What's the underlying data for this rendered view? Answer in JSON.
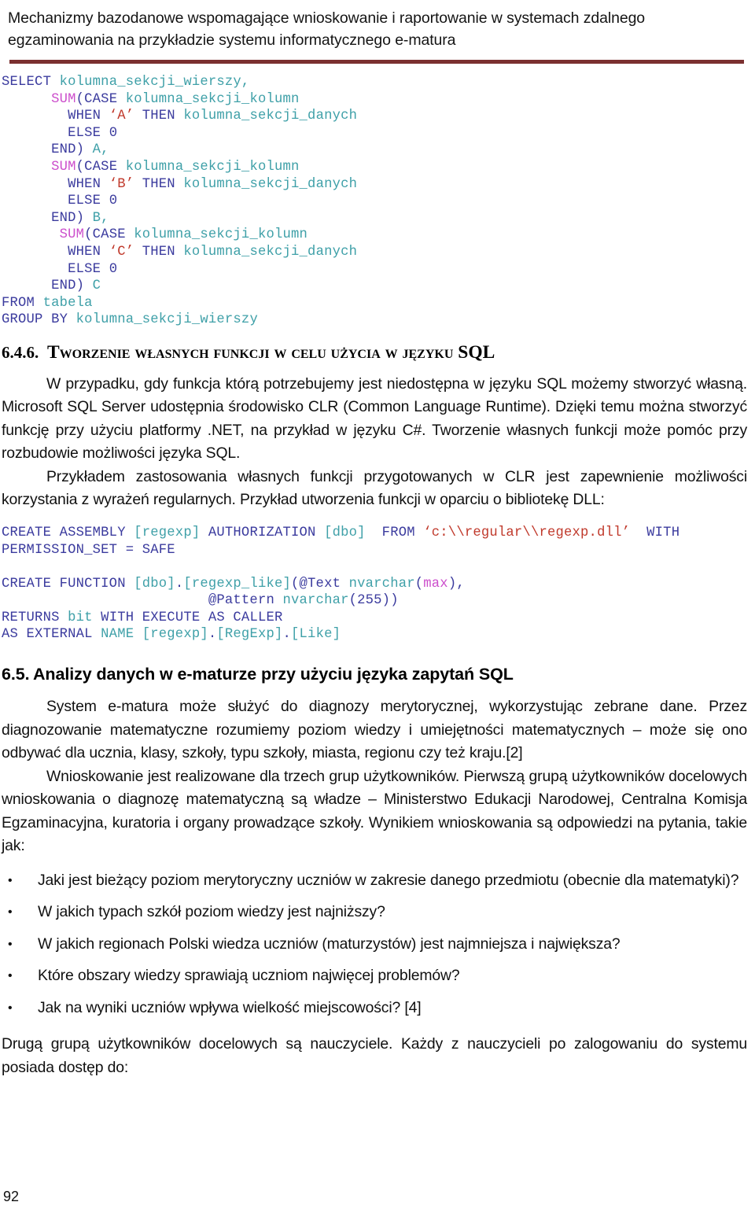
{
  "header": {
    "line1": "Mechanizmy bazodanowe wspomagające wnioskowanie i raportowanie w systemach zdalnego",
    "line2": "egzaminowania na przykładzie systemu informatycznego e-matura",
    "rule_color": "#7B3030"
  },
  "code_block_1": {
    "language": "SQL",
    "tokens": [
      [
        {
          "t": "SELECT ",
          "c": "k"
        },
        {
          "t": "kolumna_sekcji_wierszy,",
          "c": "id"
        }
      ],
      [
        {
          "t": "      ",
          "c": "pl"
        },
        {
          "t": "SUM",
          "c": "fn"
        },
        {
          "t": "(",
          "c": "pl"
        },
        {
          "t": "CASE ",
          "c": "k"
        },
        {
          "t": "kolumna_sekcji_kolumn",
          "c": "id"
        }
      ],
      [
        {
          "t": "        ",
          "c": "pl"
        },
        {
          "t": "WHEN ",
          "c": "k"
        },
        {
          "t": "‘A’",
          "c": "st"
        },
        {
          "t": " THEN ",
          "c": "k"
        },
        {
          "t": "kolumna_sekcji_danych",
          "c": "id"
        }
      ],
      [
        {
          "t": "        ",
          "c": "pl"
        },
        {
          "t": "ELSE ",
          "c": "k"
        },
        {
          "t": "0",
          "c": "num"
        }
      ],
      [
        {
          "t": "      ",
          "c": "pl"
        },
        {
          "t": "END",
          "c": "k"
        },
        {
          "t": ") ",
          "c": "pl"
        },
        {
          "t": "A,",
          "c": "id"
        }
      ],
      [
        {
          "t": "      ",
          "c": "pl"
        },
        {
          "t": "SUM",
          "c": "fn"
        },
        {
          "t": "(",
          "c": "pl"
        },
        {
          "t": "CASE ",
          "c": "k"
        },
        {
          "t": "kolumna_sekcji_kolumn",
          "c": "id"
        }
      ],
      [
        {
          "t": "        ",
          "c": "pl"
        },
        {
          "t": "WHEN ",
          "c": "k"
        },
        {
          "t": "‘B’",
          "c": "st"
        },
        {
          "t": " THEN ",
          "c": "k"
        },
        {
          "t": "kolumna_sekcji_danych",
          "c": "id"
        }
      ],
      [
        {
          "t": "        ",
          "c": "pl"
        },
        {
          "t": "ELSE ",
          "c": "k"
        },
        {
          "t": "0",
          "c": "num"
        }
      ],
      [
        {
          "t": "      ",
          "c": "pl"
        },
        {
          "t": "END",
          "c": "k"
        },
        {
          "t": ") ",
          "c": "pl"
        },
        {
          "t": "B,",
          "c": "id"
        }
      ],
      [
        {
          "t": "       ",
          "c": "pl"
        },
        {
          "t": "SUM",
          "c": "fn"
        },
        {
          "t": "(",
          "c": "pl"
        },
        {
          "t": "CASE ",
          "c": "k"
        },
        {
          "t": "kolumna_sekcji_kolumn",
          "c": "id"
        }
      ],
      [
        {
          "t": "        ",
          "c": "pl"
        },
        {
          "t": "WHEN ",
          "c": "k"
        },
        {
          "t": "‘C’",
          "c": "st"
        },
        {
          "t": " THEN ",
          "c": "k"
        },
        {
          "t": "kolumna_sekcji_danych",
          "c": "id"
        }
      ],
      [
        {
          "t": "        ",
          "c": "pl"
        },
        {
          "t": "ELSE ",
          "c": "k"
        },
        {
          "t": "0",
          "c": "num"
        }
      ],
      [
        {
          "t": "      ",
          "c": "pl"
        },
        {
          "t": "END",
          "c": "k"
        },
        {
          "t": ") ",
          "c": "pl"
        },
        {
          "t": "C",
          "c": "id"
        }
      ],
      [
        {
          "t": "FROM ",
          "c": "k"
        },
        {
          "t": "tabela",
          "c": "id"
        }
      ],
      [
        {
          "t": "GROUP BY ",
          "c": "k"
        },
        {
          "t": "kolumna_sekcji_wierszy",
          "c": "id"
        }
      ]
    ]
  },
  "heading_646": {
    "number": "6.4.6.",
    "text": "Tworzenie własnych funkcji w celu użycia w języku SQL"
  },
  "paragraphs_646": [
    "W przypadku, gdy funkcja którą potrzebujemy jest niedostępna w języku SQL możemy stworzyć własną. Microsoft SQL Server udostępnia środowisko CLR (Common Language Runtime). Dzięki temu można stworzyć funkcję przy użyciu platformy .NET, na przykład w języku C#. Tworzenie własnych funkcji może pomóc przy rozbudowie możliwości języka SQL.",
    "Przykładem zastosowania własnych funkcji przygotowanych w CLR jest zapewnienie możliwości korzystania z wyrażeń regularnych. Przykład utworzenia funkcji w oparciu o bibliotekę DLL:"
  ],
  "code_block_2": {
    "language": "SQL",
    "tokens": [
      [
        {
          "t": "CREATE ASSEMBLY ",
          "c": "k"
        },
        {
          "t": "[regexp]",
          "c": "id"
        },
        {
          "t": " AUTHORIZATION ",
          "c": "k"
        },
        {
          "t": "[dbo]",
          "c": "id"
        },
        {
          "t": "  FROM ",
          "c": "k"
        },
        {
          "t": "‘c:\\\\regular\\\\regexp.dll’",
          "c": "st"
        },
        {
          "t": "  WITH",
          "c": "k"
        }
      ],
      [
        {
          "t": "PERMISSION_SET = SAFE",
          "c": "k"
        }
      ],
      [
        {
          "t": " ",
          "c": "pl"
        }
      ],
      [
        {
          "t": "CREATE FUNCTION ",
          "c": "k"
        },
        {
          "t": "[dbo]",
          "c": "id"
        },
        {
          "t": ".",
          "c": "pl"
        },
        {
          "t": "[regexp_like]",
          "c": "id"
        },
        {
          "t": "(",
          "c": "pl"
        },
        {
          "t": "@Text ",
          "c": "k"
        },
        {
          "t": "nvarchar",
          "c": "id"
        },
        {
          "t": "(",
          "c": "pl"
        },
        {
          "t": "max",
          "c": "fn"
        },
        {
          "t": "),",
          "c": "pl"
        }
      ],
      [
        {
          "t": "                         ",
          "c": "pl"
        },
        {
          "t": "@Pattern ",
          "c": "k"
        },
        {
          "t": "nvarchar",
          "c": "id"
        },
        {
          "t": "(255))",
          "c": "pl"
        }
      ],
      [
        {
          "t": "RETURNS ",
          "c": "k"
        },
        {
          "t": "bit",
          "c": "id"
        },
        {
          "t": " WITH EXECUTE AS CALLER",
          "c": "k"
        }
      ],
      [
        {
          "t": "AS EXTERNAL ",
          "c": "k"
        },
        {
          "t": "NAME ",
          "c": "id"
        },
        {
          "t": "[regexp]",
          "c": "id"
        },
        {
          "t": ".",
          "c": "pl"
        },
        {
          "t": "[RegExp]",
          "c": "id"
        },
        {
          "t": ".",
          "c": "pl"
        },
        {
          "t": "[Like]",
          "c": "id"
        }
      ]
    ]
  },
  "heading_65": {
    "number": "6.5.",
    "text": "Analizy danych w e-maturze przy użyciu języka zapytań SQL"
  },
  "paragraphs_65": [
    "System e-matura może służyć do diagnozy merytorycznej, wykorzystując zebrane dane. Przez diagnozowanie matematyczne rozumiemy poziom wiedzy i umiejętności matematycznych – może się ono odbywać dla ucznia, klasy, szkoły, typu szkoły, miasta, regionu czy też kraju.[2]",
    "Wnioskowanie jest realizowane dla trzech grup użytkowników. Pierwszą grupą użytkowników docelowych wnioskowania o diagnozę matematyczną są władze – Ministerstwo Edukacji Narodowej, Centralna Komisja Egzaminacyjna, kuratoria i organy prowadzące szkoły. Wynikiem wnioskowania są odpowiedzi na pytania, takie jak:"
  ],
  "bullets": [
    "Jaki jest bieżący poziom merytoryczny uczniów w zakresie danego przedmiotu (obecnie dla matematyki)?",
    "W jakich typach szkół poziom wiedzy jest najniższy?",
    "W jakich regionach Polski wiedza uczniów (maturzystów) jest najmniejsza i największa?",
    "Które obszary wiedzy sprawiają uczniom najwięcej problemów?",
    "Jak na wyniki uczniów wpływa wielkość miejscowości? [4]"
  ],
  "bullet_marker": "•",
  "paragraph_tail": "Drugą grupą użytkowników docelowych są nauczyciele. Każdy z nauczycieli po zalogowaniu do systemu posiada dostęp do:",
  "page_number": "92"
}
